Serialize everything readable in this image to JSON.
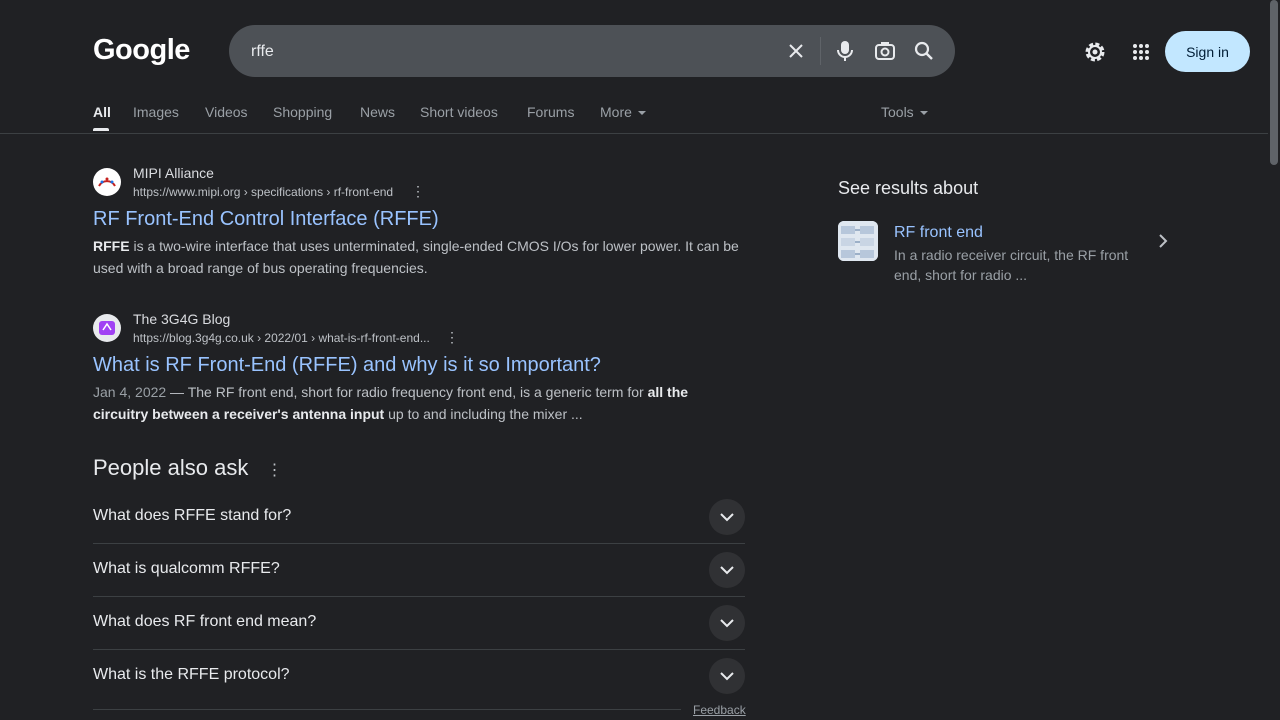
{
  "header": {
    "logo": "Google",
    "search_value": "rffe",
    "sign_in": "Sign in"
  },
  "tabs": [
    {
      "label": "All",
      "active": true
    },
    {
      "label": "Images"
    },
    {
      "label": "Videos"
    },
    {
      "label": "Shopping"
    },
    {
      "label": "News"
    },
    {
      "label": "Short videos"
    },
    {
      "label": "Forums"
    },
    {
      "label": "More"
    }
  ],
  "tools_label": "Tools",
  "results": [
    {
      "site": "MIPI Alliance",
      "url": "https://www.mipi.org › specifications › rf-front-end",
      "title": "RF Front-End Control Interface (RFFE)",
      "snippet_bold": "RFFE",
      "snippet_rest": " is a two-wire interface that uses unterminated, single-ended CMOS I/Os for lower power. It can be used with a broad range of bus operating frequencies."
    },
    {
      "site": "The 3G4G Blog",
      "url": "https://blog.3g4g.co.uk › 2022/01 › what-is-rf-front-end...",
      "title": "What is RF Front-End (RFFE) and why is it so Important?",
      "date": "Jan 4, 2022",
      "snippet_a": " — The RF front end, short for radio frequency front end, is a generic term for ",
      "snippet_bold1": "all the circuitry between a receiver's antenna input",
      "snippet_b": " up to and including the mixer ..."
    }
  ],
  "people_also_ask": {
    "heading": "People also ask",
    "questions": [
      "What does RFFE stand for?",
      "What is qualcomm RFFE?",
      "What does RF front end mean?",
      "What is the RFFE protocol?"
    ]
  },
  "feedback": "Feedback",
  "side_panel": {
    "title": "See results about",
    "entity": "RF front end",
    "description": "In a radio receiver circuit, the RF front end, short for radio ..."
  }
}
